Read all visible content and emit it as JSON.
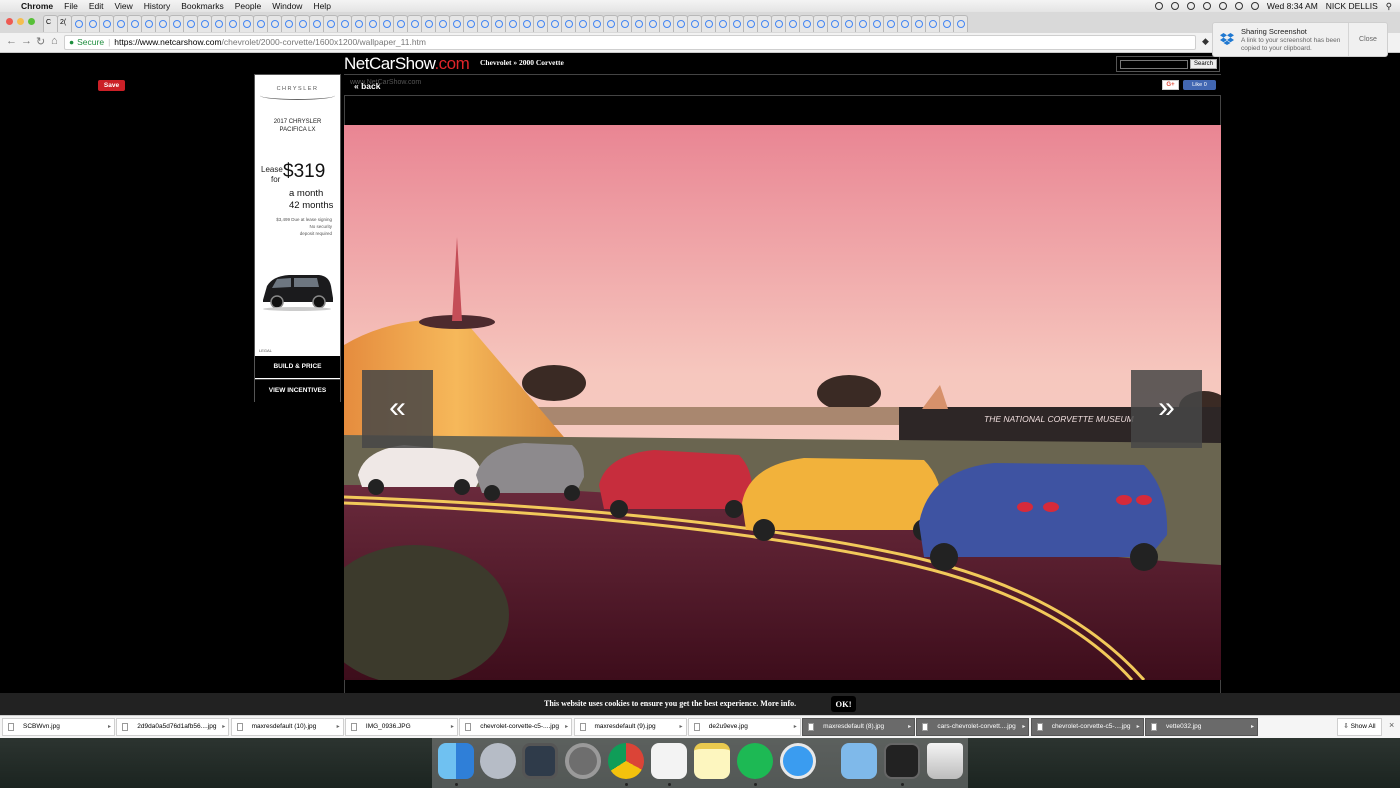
{
  "menubar": {
    "app": "Chrome",
    "items": [
      "File",
      "Edit",
      "View",
      "History",
      "Bookmarks",
      "People",
      "Window",
      "Help"
    ],
    "clock": "Wed 8:34 AM",
    "user": "NICK DELLIS"
  },
  "browser": {
    "first_tab_labels": [
      "C",
      "2("
    ],
    "tab_count": 66,
    "url_secure_label": "Secure",
    "url_host": "https://www.netcarshow.com",
    "url_path": "/chevrolet/2000-corvette/1600x1200/wallpaper_11.htm"
  },
  "notification": {
    "title": "Sharing Screenshot",
    "body": "A link to your screenshot has been copied to your clipboard.",
    "close_label": "Close"
  },
  "page": {
    "pin_label": "Save",
    "logo_part1": "NetCarShow",
    "logo_part2": ".com",
    "breadcrumb": "Chevrolet » 2000 Corvette",
    "search_button": "Search",
    "back_label": "« back",
    "watermark": "www.NetCarShow.com",
    "gplus_label": "G+",
    "fb_label": "Like 0",
    "prev_arrow": "«",
    "next_arrow": "»",
    "photo_caption": "THE NATIONAL CORVETTE MUSEUM"
  },
  "ad": {
    "brand": "CHRYSLER",
    "model_line1": "2017 CHRYSLER",
    "model_line2": "PACIFICA LX",
    "lease_line1": "Lease",
    "lease_line2": "for",
    "price": "$319",
    "per_month": "a month",
    "term": "42 months",
    "fine_print_1": "$3,499 Due at lease signing",
    "fine_print_2": "No security",
    "fine_print_3": "deposit required",
    "legal": "LEGAL",
    "button1": "BUILD & PRICE",
    "button2": "VIEW INCENTIVES"
  },
  "cookie": {
    "text": "This website uses cookies to ensure you get the best experience.",
    "link": "More info.",
    "ok": "OK!"
  },
  "downloads": {
    "items": [
      {
        "name": "SCBWvn.jpg",
        "dark": false
      },
      {
        "name": "2d9da0a5d76d1afb56....jpg",
        "dark": false
      },
      {
        "name": "maxresdefault (10).jpg",
        "dark": false
      },
      {
        "name": "IMG_0936.JPG",
        "dark": false
      },
      {
        "name": "chevrolet-corvette-c5-....jpg",
        "dark": false
      },
      {
        "name": "maxresdefault (9).jpg",
        "dark": false
      },
      {
        "name": "de2u9eve.jpg",
        "dark": false
      },
      {
        "name": "maxresdefault (8).jpg",
        "dark": true
      },
      {
        "name": "cars-chevrolet-corvett....jpg",
        "dark": true
      },
      {
        "name": "chevrolet-corvette-c5-....jpg",
        "dark": true
      },
      {
        "name": "vette032.jpg",
        "dark": true
      }
    ],
    "show_all": "Show All"
  },
  "dock": {
    "apps": [
      "finder-icon",
      "launchpad-icon",
      "photo-app-icon",
      "system-preferences-icon",
      "chrome-icon",
      "slack-icon",
      "notes-icon",
      "spotify-icon",
      "safari-icon",
      "downloads-folder-icon",
      "screenshot-icon",
      "trash-icon"
    ]
  },
  "colors": {
    "logo_red": "#e0252a",
    "pinterest_red": "#cb2027",
    "facebook_blue": "#4267b2",
    "secure_green": "#1e8e3e"
  }
}
